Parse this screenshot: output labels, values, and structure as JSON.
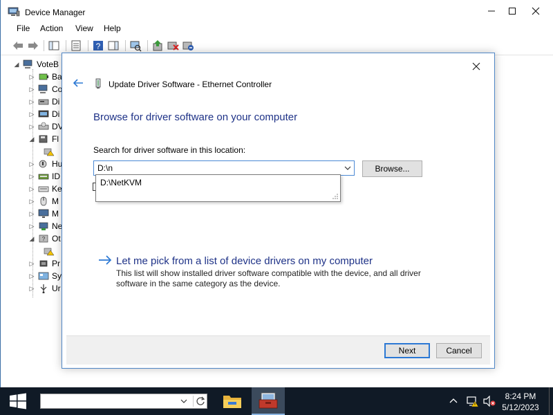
{
  "device_manager": {
    "title": "Device Manager",
    "menu": [
      "File",
      "Action",
      "View",
      "Help"
    ],
    "tree": {
      "root": "VoteB",
      "items": [
        {
          "label": "Ba",
          "icon": "battery-icon"
        },
        {
          "label": "Co",
          "icon": "computer-icon"
        },
        {
          "label": "Di",
          "icon": "disk-drive-icon"
        },
        {
          "label": "Di",
          "icon": "display-adapter-icon"
        },
        {
          "label": "DV",
          "icon": "dvd-drive-icon"
        },
        {
          "label": "Fl",
          "icon": "floppy-controller-icon"
        },
        {
          "label": "",
          "icon": "warning-device-icon"
        },
        {
          "label": "Hu",
          "icon": "hid-icon"
        },
        {
          "label": "ID",
          "icon": "ide-controller-icon"
        },
        {
          "label": "Ke",
          "icon": "keyboard-icon"
        },
        {
          "label": "M",
          "icon": "mouse-icon"
        },
        {
          "label": "M",
          "icon": "monitor-icon"
        },
        {
          "label": "Ne",
          "icon": "network-adapter-icon"
        },
        {
          "label": "Ot",
          "icon": "other-devices-icon"
        },
        {
          "label": "",
          "icon": "warning-device-icon"
        },
        {
          "label": "Pr",
          "icon": "processor-icon"
        },
        {
          "label": "Sy",
          "icon": "system-devices-icon"
        },
        {
          "label": "Ur",
          "icon": "usb-controller-icon"
        }
      ]
    }
  },
  "dialog": {
    "header_title": "Update Driver Software - Ethernet Controller",
    "heading": "Browse for driver software on your computer",
    "search_label": "Search for driver software in this location:",
    "path_value": "D:\\n",
    "browse_label": "Browse...",
    "autocomplete": [
      "D:\\NetKVM"
    ],
    "pick_link": "Let me pick from a list of device drivers on my computer",
    "pick_desc": "This list will show installed driver software compatible with the device, and all driver software in the same category as the device.",
    "next_label": "Next",
    "cancel_label": "Cancel"
  },
  "taskbar": {
    "time": "8:24 PM",
    "date": "5/12/2023"
  },
  "colors": {
    "heading_blue": "#1e3287",
    "accent_blue": "#2b78d4",
    "taskbar_bg": "#101a26"
  }
}
